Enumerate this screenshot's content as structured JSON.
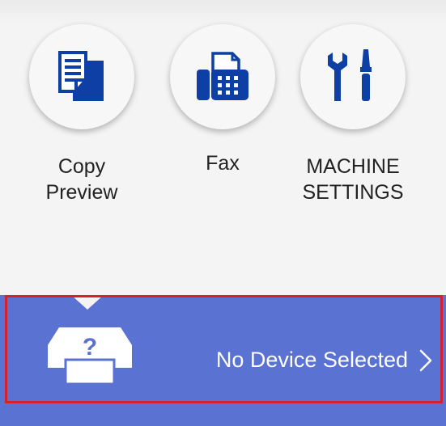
{
  "menu": {
    "items": [
      {
        "label": "Copy\nPreview",
        "icon": "copy-preview-icon"
      },
      {
        "label": "Fax",
        "icon": "fax-icon"
      },
      {
        "label": "MACHINE\nSETTINGS",
        "icon": "wrench-screwdriver-icon"
      }
    ]
  },
  "device": {
    "status_text": "No Device Selected",
    "icon": "unknown-printer-icon",
    "chevron_icon": "chevron-right-icon"
  },
  "colors": {
    "accent": "#0d3fa5",
    "bar": "#5a72d2",
    "highlight_border": "#d52030",
    "background": "#f4f4f4"
  }
}
